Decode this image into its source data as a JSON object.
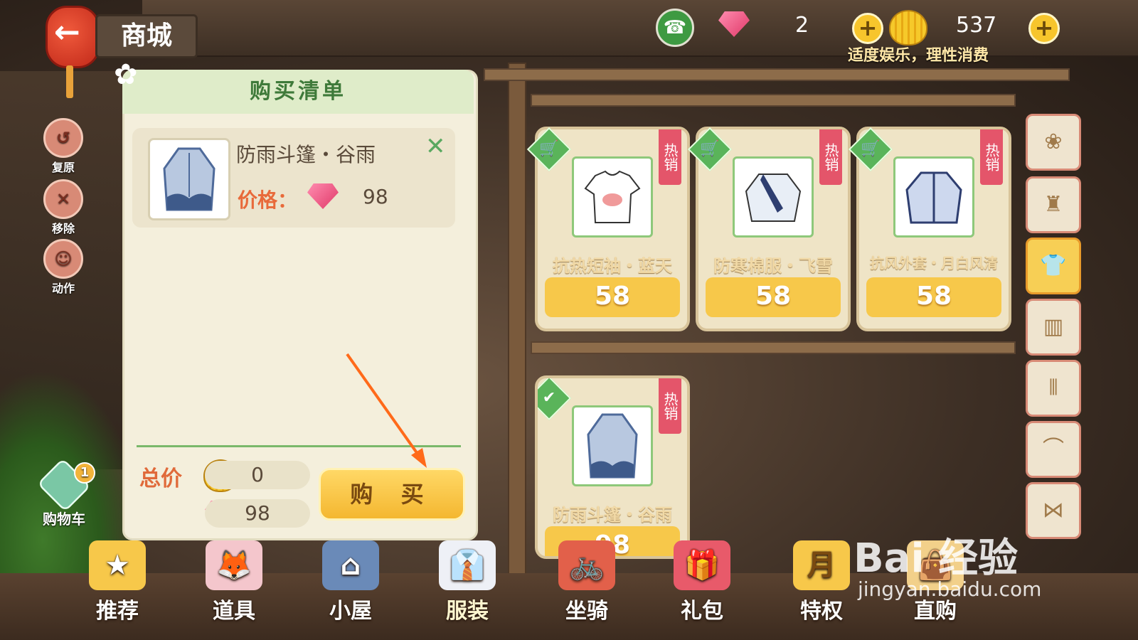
{
  "header": {
    "title": "商城",
    "gems": "2",
    "coins": "537",
    "notice": "适度娱乐，理性消费"
  },
  "side_actions": [
    {
      "label": "复原"
    },
    {
      "label": "移除"
    },
    {
      "label": "动作"
    }
  ],
  "cart": {
    "label": "购物车",
    "count": "1"
  },
  "purchase_list": {
    "title": "购买清单",
    "item": {
      "name": "防雨斗篷・谷雨",
      "price_label": "价格：",
      "price": "98"
    },
    "total_label": "总价",
    "total_coins": "0",
    "total_gems": "98",
    "buy_label": "购 买"
  },
  "products": [
    {
      "name": "抗热短袖・蓝天",
      "price": "58",
      "hot": "热销",
      "tag": "cart"
    },
    {
      "name": "防寒棉服・飞雪",
      "price": "58",
      "hot": "热销",
      "tag": "cart"
    },
    {
      "name": "抗风外套・月白风清",
      "price": "58",
      "hot": "热销",
      "tag": "cart"
    },
    {
      "name": "防雨斗篷・谷雨",
      "price": "98",
      "hot": "热销",
      "tag": "check"
    }
  ],
  "categories": [
    {
      "icon": "set-icon"
    },
    {
      "icon": "dress-icon"
    },
    {
      "icon": "shirt-icon",
      "active": true
    },
    {
      "icon": "shorts-icon"
    },
    {
      "icon": "shoes-icon"
    },
    {
      "icon": "hat-icon"
    },
    {
      "icon": "bow-icon"
    }
  ],
  "bottom_nav": [
    {
      "label": "推荐"
    },
    {
      "label": "道具"
    },
    {
      "label": "小屋"
    },
    {
      "label": "服装",
      "active": true
    },
    {
      "label": "坐骑"
    },
    {
      "label": "礼包"
    },
    {
      "label": "特权"
    },
    {
      "label": "直购"
    }
  ],
  "watermark": {
    "brand": "Bai 经验",
    "url": "jingyan.baidu.com"
  },
  "colors": {
    "accent": "#f7c84a",
    "hot_tag": "#e4556a",
    "panel": "#f4efdc",
    "green": "#5ab45a"
  }
}
